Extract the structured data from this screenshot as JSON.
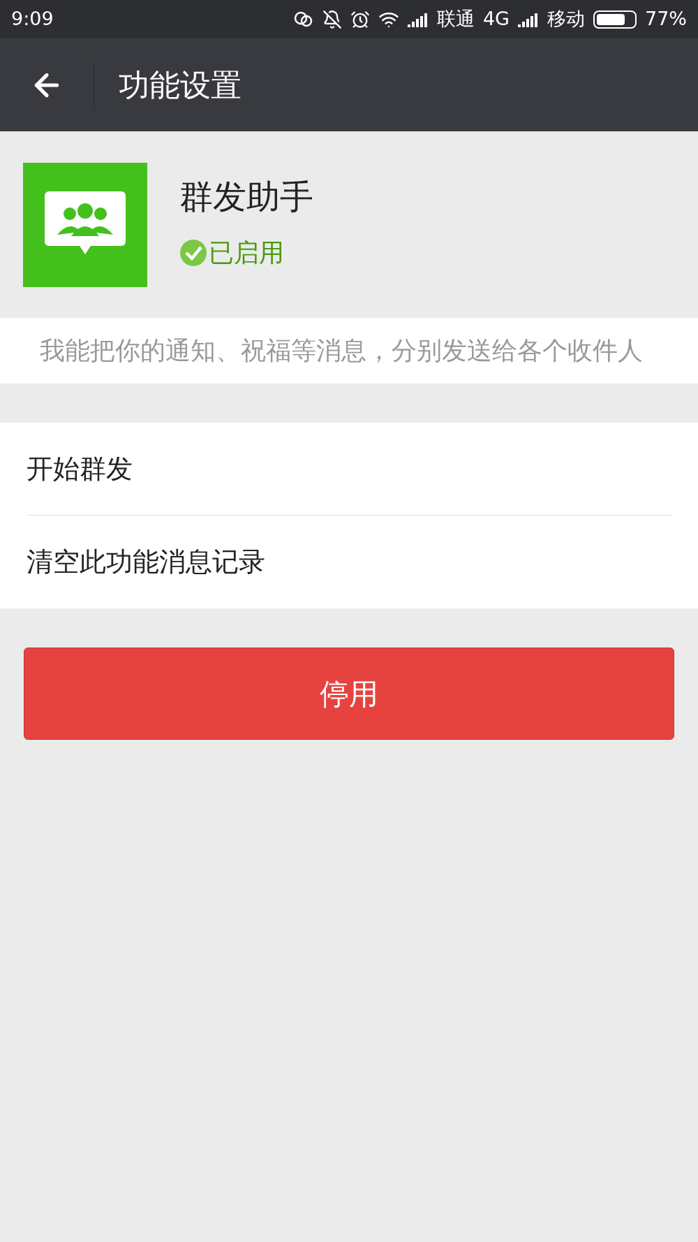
{
  "status_bar": {
    "time": "9:09",
    "carrier_1": "联通",
    "network_1": "4G",
    "carrier_2": "移动",
    "battery": "77%"
  },
  "top_bar": {
    "title": "功能设置"
  },
  "feature": {
    "name": "群发助手",
    "status": "已启用",
    "enabled": true
  },
  "description": "我能把你的通知、祝福等消息，分别发送给各个收件人",
  "menu_items": [
    {
      "label": "开始群发"
    },
    {
      "label": "清空此功能消息记录"
    }
  ],
  "button": {
    "label": "停用"
  }
}
